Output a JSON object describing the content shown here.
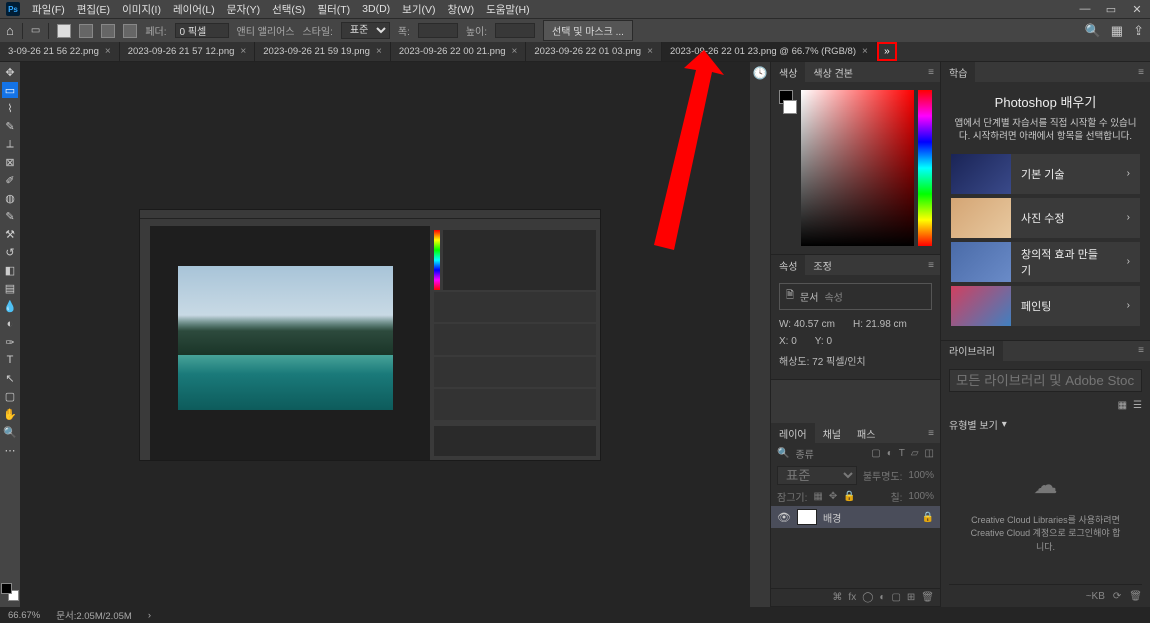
{
  "menubar": {
    "items": [
      "파일(F)",
      "편집(E)",
      "이미지(I)",
      "레이어(L)",
      "문자(Y)",
      "선택(S)",
      "필터(T)",
      "3D(D)",
      "보기(V)",
      "창(W)",
      "도움말(H)"
    ]
  },
  "optbar": {
    "feather_label": "페더:",
    "feather_value": "0 픽셀",
    "antialias_label": "앤티 앨리어스",
    "style_label": "스타일:",
    "style_value": "표준",
    "width_label": "폭:",
    "height_label": "높이:",
    "select_mask_btn": "선택 및 마스크 ..."
  },
  "tabs": [
    "3-09-26 21 56 22.png",
    "2023-09-26 21 57 12.png",
    "2023-09-26 21 59 19.png",
    "2023-09-26 22 00 21.png",
    "2023-09-26 22 01 03.png",
    "2023-09-26 22 01 23.png @ 66.7% (RGB/8)"
  ],
  "active_tab_index": 5,
  "panels": {
    "color": {
      "tab1": "색상",
      "tab2": "색상 견본"
    },
    "properties": {
      "tab1": "속성",
      "tab2": "조정",
      "doc_label": "문서",
      "doc_suffix": "속성",
      "w_label": "W:",
      "w_value": "40.57 cm",
      "h_label": "H:",
      "h_value": "21.98 cm",
      "x_label": "X:",
      "x_value": "0",
      "y_label": "Y:",
      "y_value": "0",
      "resolution": "해상도: 72 픽셀/인치"
    },
    "layers": {
      "tab1": "레이어",
      "tab2": "채널",
      "tab3": "패스",
      "type_label": "종류",
      "blend_normal": "표준",
      "opacity_label": "불투명도:",
      "opacity_value": "100%",
      "lock_label": "잠그기:",
      "fill_label": "칠:",
      "fill_value": "100%",
      "bg_layer": "배경"
    },
    "learn": {
      "tab": "학습",
      "title": "Photoshop 배우기",
      "desc": "앱에서 단계별 자습서를 직접 시작할 수 있습니다. 시작하려면 아래에서 항목을 선택합니다.",
      "items": [
        "기본 기술",
        "사진 수정",
        "창의적 효과 만들기",
        "페인팅"
      ]
    },
    "libraries": {
      "tab": "라이브러리",
      "search_placeholder": "모든 라이브러리 및 Adobe Stock 검색",
      "view_label": "유형별 보기",
      "cc_msg": "Creative Cloud Libraries를 사용하려면 Creative Cloud 계정으로 로그인해야 합니다."
    }
  },
  "statusbar": {
    "zoom": "66.67%",
    "doc": "문서:2.05M/2.05M",
    "right": "~KB"
  }
}
